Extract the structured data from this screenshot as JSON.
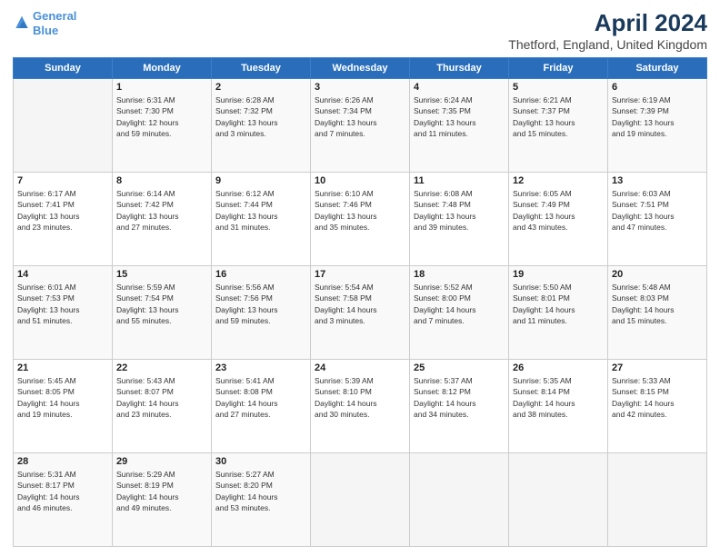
{
  "logo": {
    "line1": "General",
    "line2": "Blue"
  },
  "header": {
    "title": "April 2024",
    "subtitle": "Thetford, England, United Kingdom"
  },
  "days_of_week": [
    "Sunday",
    "Monday",
    "Tuesday",
    "Wednesday",
    "Thursday",
    "Friday",
    "Saturday"
  ],
  "weeks": [
    [
      {
        "day": "",
        "detail": ""
      },
      {
        "day": "1",
        "detail": "Sunrise: 6:31 AM\nSunset: 7:30 PM\nDaylight: 12 hours\nand 59 minutes."
      },
      {
        "day": "2",
        "detail": "Sunrise: 6:28 AM\nSunset: 7:32 PM\nDaylight: 13 hours\nand 3 minutes."
      },
      {
        "day": "3",
        "detail": "Sunrise: 6:26 AM\nSunset: 7:34 PM\nDaylight: 13 hours\nand 7 minutes."
      },
      {
        "day": "4",
        "detail": "Sunrise: 6:24 AM\nSunset: 7:35 PM\nDaylight: 13 hours\nand 11 minutes."
      },
      {
        "day": "5",
        "detail": "Sunrise: 6:21 AM\nSunset: 7:37 PM\nDaylight: 13 hours\nand 15 minutes."
      },
      {
        "day": "6",
        "detail": "Sunrise: 6:19 AM\nSunset: 7:39 PM\nDaylight: 13 hours\nand 19 minutes."
      }
    ],
    [
      {
        "day": "7",
        "detail": "Sunrise: 6:17 AM\nSunset: 7:41 PM\nDaylight: 13 hours\nand 23 minutes."
      },
      {
        "day": "8",
        "detail": "Sunrise: 6:14 AM\nSunset: 7:42 PM\nDaylight: 13 hours\nand 27 minutes."
      },
      {
        "day": "9",
        "detail": "Sunrise: 6:12 AM\nSunset: 7:44 PM\nDaylight: 13 hours\nand 31 minutes."
      },
      {
        "day": "10",
        "detail": "Sunrise: 6:10 AM\nSunset: 7:46 PM\nDaylight: 13 hours\nand 35 minutes."
      },
      {
        "day": "11",
        "detail": "Sunrise: 6:08 AM\nSunset: 7:48 PM\nDaylight: 13 hours\nand 39 minutes."
      },
      {
        "day": "12",
        "detail": "Sunrise: 6:05 AM\nSunset: 7:49 PM\nDaylight: 13 hours\nand 43 minutes."
      },
      {
        "day": "13",
        "detail": "Sunrise: 6:03 AM\nSunset: 7:51 PM\nDaylight: 13 hours\nand 47 minutes."
      }
    ],
    [
      {
        "day": "14",
        "detail": "Sunrise: 6:01 AM\nSunset: 7:53 PM\nDaylight: 13 hours\nand 51 minutes."
      },
      {
        "day": "15",
        "detail": "Sunrise: 5:59 AM\nSunset: 7:54 PM\nDaylight: 13 hours\nand 55 minutes."
      },
      {
        "day": "16",
        "detail": "Sunrise: 5:56 AM\nSunset: 7:56 PM\nDaylight: 13 hours\nand 59 minutes."
      },
      {
        "day": "17",
        "detail": "Sunrise: 5:54 AM\nSunset: 7:58 PM\nDaylight: 14 hours\nand 3 minutes."
      },
      {
        "day": "18",
        "detail": "Sunrise: 5:52 AM\nSunset: 8:00 PM\nDaylight: 14 hours\nand 7 minutes."
      },
      {
        "day": "19",
        "detail": "Sunrise: 5:50 AM\nSunset: 8:01 PM\nDaylight: 14 hours\nand 11 minutes."
      },
      {
        "day": "20",
        "detail": "Sunrise: 5:48 AM\nSunset: 8:03 PM\nDaylight: 14 hours\nand 15 minutes."
      }
    ],
    [
      {
        "day": "21",
        "detail": "Sunrise: 5:45 AM\nSunset: 8:05 PM\nDaylight: 14 hours\nand 19 minutes."
      },
      {
        "day": "22",
        "detail": "Sunrise: 5:43 AM\nSunset: 8:07 PM\nDaylight: 14 hours\nand 23 minutes."
      },
      {
        "day": "23",
        "detail": "Sunrise: 5:41 AM\nSunset: 8:08 PM\nDaylight: 14 hours\nand 27 minutes."
      },
      {
        "day": "24",
        "detail": "Sunrise: 5:39 AM\nSunset: 8:10 PM\nDaylight: 14 hours\nand 30 minutes."
      },
      {
        "day": "25",
        "detail": "Sunrise: 5:37 AM\nSunset: 8:12 PM\nDaylight: 14 hours\nand 34 minutes."
      },
      {
        "day": "26",
        "detail": "Sunrise: 5:35 AM\nSunset: 8:14 PM\nDaylight: 14 hours\nand 38 minutes."
      },
      {
        "day": "27",
        "detail": "Sunrise: 5:33 AM\nSunset: 8:15 PM\nDaylight: 14 hours\nand 42 minutes."
      }
    ],
    [
      {
        "day": "28",
        "detail": "Sunrise: 5:31 AM\nSunset: 8:17 PM\nDaylight: 14 hours\nand 46 minutes."
      },
      {
        "day": "29",
        "detail": "Sunrise: 5:29 AM\nSunset: 8:19 PM\nDaylight: 14 hours\nand 49 minutes."
      },
      {
        "day": "30",
        "detail": "Sunrise: 5:27 AM\nSunset: 8:20 PM\nDaylight: 14 hours\nand 53 minutes."
      },
      {
        "day": "",
        "detail": ""
      },
      {
        "day": "",
        "detail": ""
      },
      {
        "day": "",
        "detail": ""
      },
      {
        "day": "",
        "detail": ""
      }
    ]
  ]
}
